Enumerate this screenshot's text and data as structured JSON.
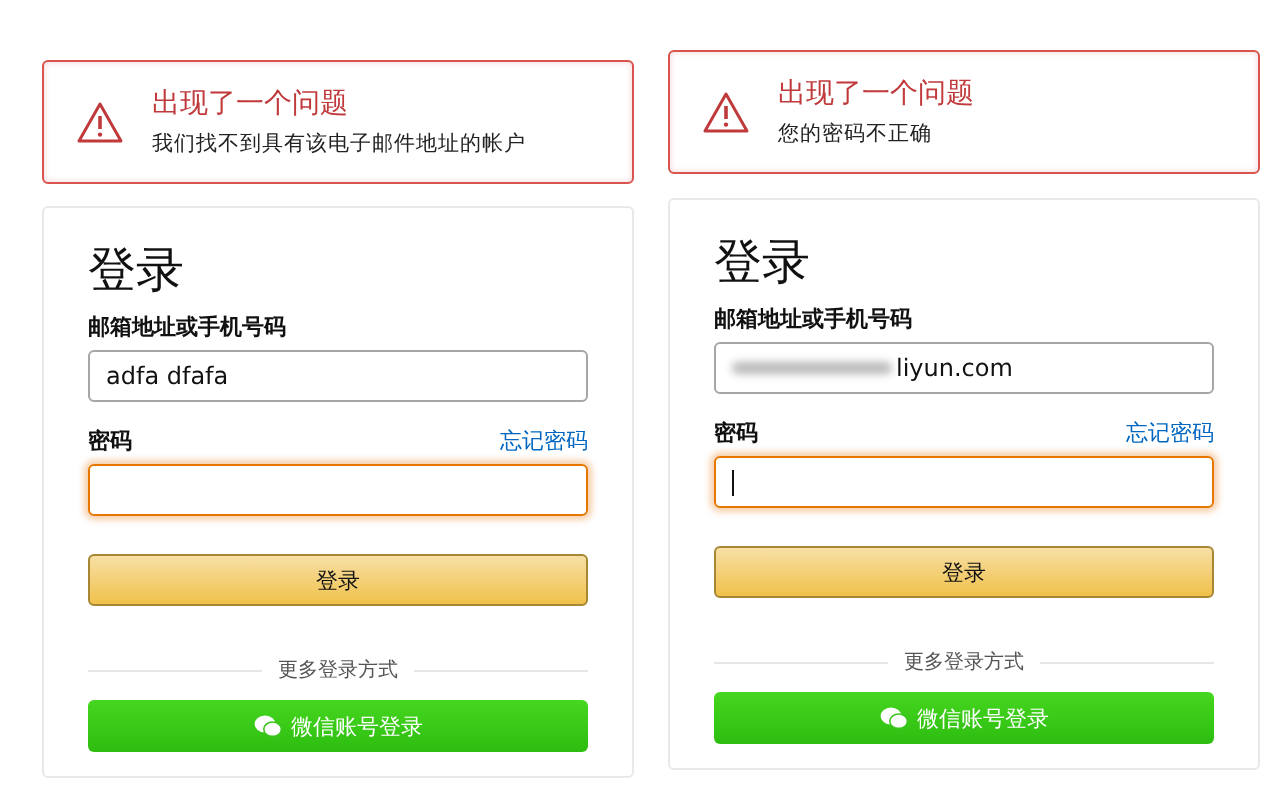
{
  "panels": [
    {
      "alert": {
        "title": "出现了一个问题",
        "message": "我们找不到具有该电子邮件地址的帐户"
      },
      "form": {
        "title": "登录",
        "email_label": "邮箱地址或手机号码",
        "email_value": "adfa dfafa",
        "email_redacted": false,
        "password_label": "密码",
        "forgot_link": "忘记密码",
        "password_focused": true,
        "caret": false,
        "submit": "登录",
        "divider": "更多登录方式",
        "wechat": "微信账号登录"
      }
    },
    {
      "alert": {
        "title": "出现了一个问题",
        "message": "您的密码不正确"
      },
      "form": {
        "title": "登录",
        "email_label": "邮箱地址或手机号码",
        "email_value": "liyun.com",
        "email_redacted": true,
        "password_label": "密码",
        "forgot_link": "忘记密码",
        "password_focused": true,
        "caret": true,
        "submit": "登录",
        "divider": "更多登录方式",
        "wechat": "微信账号登录"
      }
    }
  ]
}
